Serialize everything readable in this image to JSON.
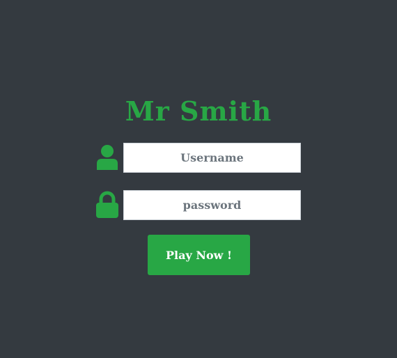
{
  "app": {
    "title": "Mr Smith"
  },
  "login": {
    "username_placeholder": "Username",
    "password_placeholder": "password",
    "submit_label": "Play Now !"
  },
  "icons": {
    "username": "user-icon",
    "password": "lock-icon"
  },
  "colors": {
    "background": "#343a40",
    "accent": "#28a745",
    "input_background": "#ffffff",
    "placeholder_text": "#6c757d",
    "button_text": "#ffffff"
  }
}
